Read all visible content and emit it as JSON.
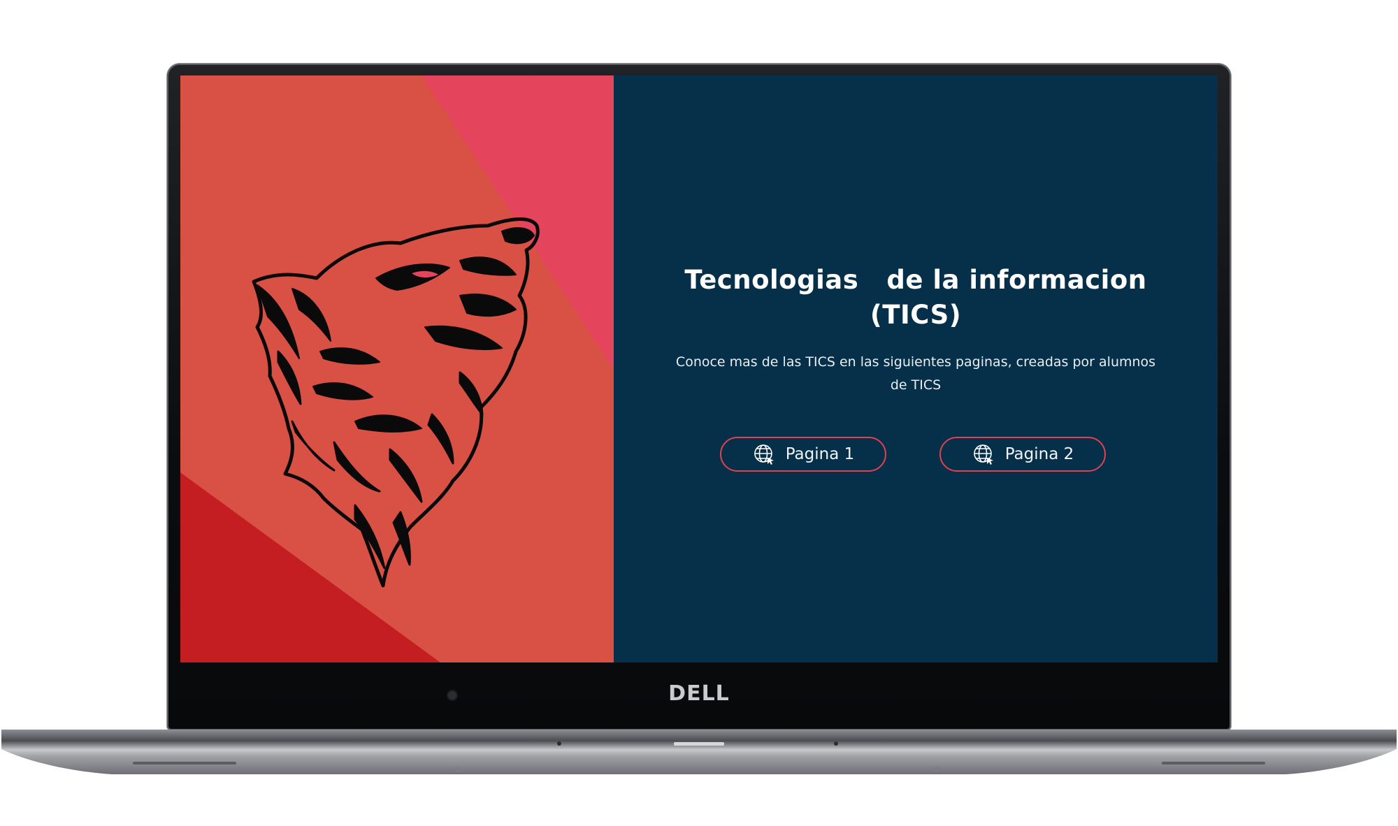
{
  "hero": {
    "title": "Tecnologias   de la informacion\n(TICS)",
    "subtitle": "Conoce mas de las TICS en las siguientes paginas, creadas por alumnos de TICS"
  },
  "buttons": [
    {
      "label": "Pagina 1",
      "icon": "globe-icon"
    },
    {
      "label": "Pagina 2",
      "icon": "globe-icon"
    }
  ],
  "device": {
    "brand": "DELL"
  },
  "colors": {
    "left_bg": "#d95045",
    "left_accent_pink": "#e4455d",
    "left_accent_red": "#c41e22",
    "right_bg": "#06304a",
    "button_border": "#e3404f"
  }
}
